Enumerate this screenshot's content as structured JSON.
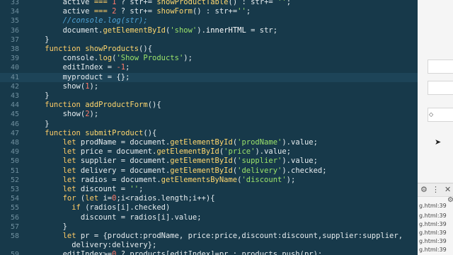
{
  "editor": {
    "lines": [
      {
        "n": "33",
        "tokens": [
          [
            "pl",
            "        active "
          ],
          [
            "kw",
            "==="
          ],
          [
            "pl",
            " "
          ],
          [
            "num",
            "1"
          ],
          [
            "pl",
            " ? "
          ],
          [
            "pl",
            "str"
          ],
          [
            "pl",
            "+= "
          ],
          [
            "fn",
            "showProductTable"
          ],
          [
            "pl",
            "() : "
          ],
          [
            "pl",
            "str"
          ],
          [
            "pl",
            "+= "
          ],
          [
            "str",
            "''"
          ],
          [
            "pl",
            ";"
          ]
        ]
      },
      {
        "n": "34",
        "tokens": [
          [
            "pl",
            "        active "
          ],
          [
            "kw",
            "==="
          ],
          [
            "pl",
            " "
          ],
          [
            "num",
            "2"
          ],
          [
            "pl",
            " ? "
          ],
          [
            "pl",
            "str"
          ],
          [
            "pl",
            "+= "
          ],
          [
            "fn",
            "showForm"
          ],
          [
            "pl",
            "() : "
          ],
          [
            "pl",
            "str"
          ],
          [
            "pl",
            "+="
          ],
          [
            "str",
            "''"
          ],
          [
            "pl",
            ";"
          ]
        ]
      },
      {
        "n": "35",
        "tokens": [
          [
            "com",
            "        //console.log(str);"
          ]
        ]
      },
      {
        "n": "36",
        "tokens": [
          [
            "pl",
            "        document."
          ],
          [
            "fn",
            "getElementById"
          ],
          [
            "pl",
            "("
          ],
          [
            "str",
            "'show'"
          ],
          [
            "pl",
            ")."
          ],
          [
            "pr",
            "innerHTML"
          ],
          [
            "pl",
            " = str;"
          ]
        ]
      },
      {
        "n": "37",
        "tokens": [
          [
            "pl",
            "    }"
          ]
        ]
      },
      {
        "n": "38",
        "tokens": [
          [
            "kw",
            "    function "
          ],
          [
            "fn",
            "showProducts"
          ],
          [
            "pl",
            "(){"
          ]
        ]
      },
      {
        "n": "39",
        "tokens": [
          [
            "pl",
            "        console."
          ],
          [
            "fn",
            "log"
          ],
          [
            "pl",
            "("
          ],
          [
            "str",
            "'Show Products'"
          ],
          [
            "pl",
            ");"
          ]
        ]
      },
      {
        "n": "40",
        "tokens": [
          [
            "pl",
            "        editIndex = "
          ],
          [
            "num",
            "-1"
          ],
          [
            "pl",
            ";"
          ]
        ]
      },
      {
        "n": "41",
        "tokens": [
          [
            "pl",
            "        myproduct = {};"
          ]
        ]
      },
      {
        "n": "42",
        "tokens": [
          [
            "pl",
            "        show("
          ],
          [
            "num",
            "1"
          ],
          [
            "pl",
            ");"
          ]
        ]
      },
      {
        "n": "43",
        "tokens": [
          [
            "pl",
            "    }"
          ]
        ]
      },
      {
        "n": "44",
        "tokens": [
          [
            "kw",
            "    function "
          ],
          [
            "fn",
            "addProductForm"
          ],
          [
            "pl",
            "(){"
          ]
        ]
      },
      {
        "n": "45",
        "tokens": [
          [
            "pl",
            "        show("
          ],
          [
            "num",
            "2"
          ],
          [
            "pl",
            ");"
          ]
        ]
      },
      {
        "n": "46",
        "tokens": [
          [
            "pl",
            "    }"
          ]
        ]
      },
      {
        "n": "47",
        "tokens": [
          [
            "kw",
            "    function "
          ],
          [
            "fn",
            "submitProduct"
          ],
          [
            "pl",
            "(){"
          ]
        ]
      },
      {
        "n": "48",
        "tokens": [
          [
            "kw",
            "        let "
          ],
          [
            "pl",
            "prodName = document."
          ],
          [
            "fn",
            "getElementById"
          ],
          [
            "pl",
            "("
          ],
          [
            "str",
            "'prodName'"
          ],
          [
            "pl",
            ").value;"
          ]
        ]
      },
      {
        "n": "49",
        "tokens": [
          [
            "kw",
            "        let "
          ],
          [
            "pl",
            "price = document."
          ],
          [
            "fn",
            "getElementById"
          ],
          [
            "pl",
            "("
          ],
          [
            "str",
            "'price'"
          ],
          [
            "pl",
            ").value;"
          ]
        ]
      },
      {
        "n": "50",
        "tokens": [
          [
            "kw",
            "        let "
          ],
          [
            "pl",
            "supplier = document."
          ],
          [
            "fn",
            "getElementById"
          ],
          [
            "pl",
            "("
          ],
          [
            "str",
            "'supplier'"
          ],
          [
            "pl",
            ").value;"
          ]
        ]
      },
      {
        "n": "51",
        "tokens": [
          [
            "kw",
            "        let "
          ],
          [
            "pl",
            "delivery = document."
          ],
          [
            "fn",
            "getElementById"
          ],
          [
            "pl",
            "("
          ],
          [
            "str",
            "'delivery'"
          ],
          [
            "pl",
            ").checked;"
          ]
        ]
      },
      {
        "n": "52",
        "tokens": [
          [
            "kw",
            "        let "
          ],
          [
            "pl",
            "radios = document."
          ],
          [
            "fn",
            "getElementsByName"
          ],
          [
            "pl",
            "("
          ],
          [
            "str",
            "'discount'"
          ],
          [
            "pl",
            ");"
          ]
        ]
      },
      {
        "n": "53",
        "tokens": [
          [
            "kw",
            "        let "
          ],
          [
            "pl",
            "discount = "
          ],
          [
            "str",
            "''"
          ],
          [
            "pl",
            ";"
          ]
        ]
      },
      {
        "n": "54",
        "tokens": [
          [
            "kw",
            "        for "
          ],
          [
            "pl",
            "("
          ],
          [
            "kw",
            "let "
          ],
          [
            "pl",
            "i="
          ],
          [
            "num",
            "0"
          ],
          [
            "pl",
            ";i<radios.length;i++){"
          ]
        ]
      },
      {
        "n": "55",
        "tokens": [
          [
            "kw",
            "          if "
          ],
          [
            "pl",
            "(radios[i].checked)"
          ]
        ]
      },
      {
        "n": "56",
        "tokens": [
          [
            "pl",
            "            discount = radios[i].value;"
          ]
        ]
      },
      {
        "n": "57",
        "tokens": [
          [
            "pl",
            "        }"
          ]
        ]
      },
      {
        "n": "58",
        "tokens": [
          [
            "kw",
            "        let "
          ],
          [
            "pl",
            "pr = {product:prodName, price:price,discount:discount,supplier:supplier,"
          ]
        ]
      },
      {
        "n": "",
        "tokens": [
          [
            "pl",
            "          delivery:delivery};"
          ]
        ]
      },
      {
        "n": "59",
        "tokens": [
          [
            "pl",
            "        editIndex>="
          ],
          [
            "num",
            "0"
          ],
          [
            "pl",
            " ? products[editIndex]=pr : products.push(pr);"
          ]
        ]
      }
    ],
    "active_line": "41"
  },
  "side": {
    "select_arrow": "◇",
    "log_links": [
      "g.html:39",
      "g.html:39",
      "g.html:39",
      "g.html:39",
      "g.html:39",
      "g.html:39",
      "g.html:39"
    ],
    "icons": {
      "settings": "gear-icon",
      "close": "close-icon"
    }
  },
  "colors": {
    "editor_bg": "#17394a",
    "keyword": "#ffcc66",
    "string": "#9be36a",
    "number": "#ff7a6b",
    "comment": "#4fa3d6"
  }
}
